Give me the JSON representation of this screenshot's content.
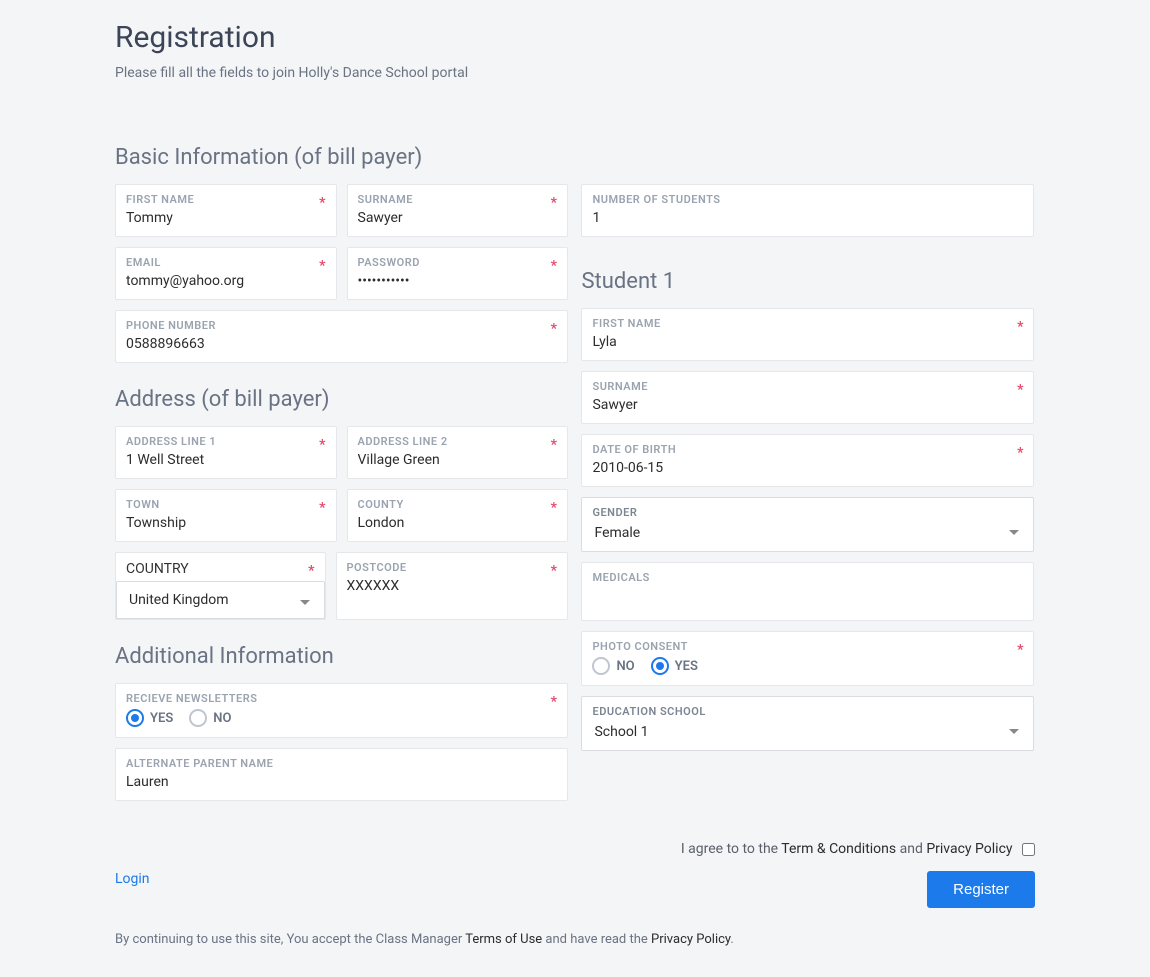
{
  "page": {
    "title": "Registration",
    "subtitle": "Please fill all the fields to join Holly's Dance School portal"
  },
  "sections": {
    "basic_title": "Basic Information (of bill payer)",
    "address_title": "Address (of bill payer)",
    "additional_title": "Additional Information",
    "student1_title": "Student 1"
  },
  "labels": {
    "first_name": "FIRST NAME",
    "surname": "SURNAME",
    "number_students": "NUMBER OF STUDENTS",
    "email": "EMAIL",
    "password": "PASSWORD",
    "phone": "PHONE NUMBER",
    "addr1": "ADDRESS LINE 1",
    "addr2": "ADDRESS LINE 2",
    "town": "TOWN",
    "county": "COUNTY",
    "country": "COUNTRY",
    "postcode": "POSTCODE",
    "newsletters": "RECIEVE NEWSLETTERS",
    "alt_parent": "ALTERNATE PARENT NAME",
    "dob": "DATE OF BIRTH",
    "gender": "GENDER",
    "medicals": "MEDICALS",
    "photo_consent": "PHOTO CONSENT",
    "edu_school": "EDUCATION SCHOOL",
    "yes": "YES",
    "no": "NO"
  },
  "values": {
    "first_name": "Tommy",
    "surname": "Sawyer",
    "number_students": "1",
    "email": "tommy@yahoo.org",
    "password": "•••••••••••",
    "phone": "0588896663",
    "addr1": "1 Well Street",
    "addr2": "Village Green",
    "town": "Township",
    "county": "London",
    "country": "United Kingdom",
    "postcode": "XXXXXX",
    "alt_parent": "Lauren",
    "student_first_name": "Lyla",
    "student_surname": "Sawyer",
    "student_dob": "2010-06-15",
    "gender": "Female",
    "medicals": "",
    "edu_school": "School 1"
  },
  "buttons": {
    "login": "Login",
    "register": "Register"
  },
  "footer": {
    "agree_prefix": "I agree to to the ",
    "terms": "Term & Conditions",
    "and": " and ",
    "privacy": "Privacy Policy",
    "legal_prefix": "By continuing to use this site, You accept the Class Manager ",
    "terms_of_use": "Terms of Use",
    "legal_mid": " and have read the ",
    "privacy2": "Privacy Policy",
    "dot": "."
  },
  "asterisk": "*"
}
